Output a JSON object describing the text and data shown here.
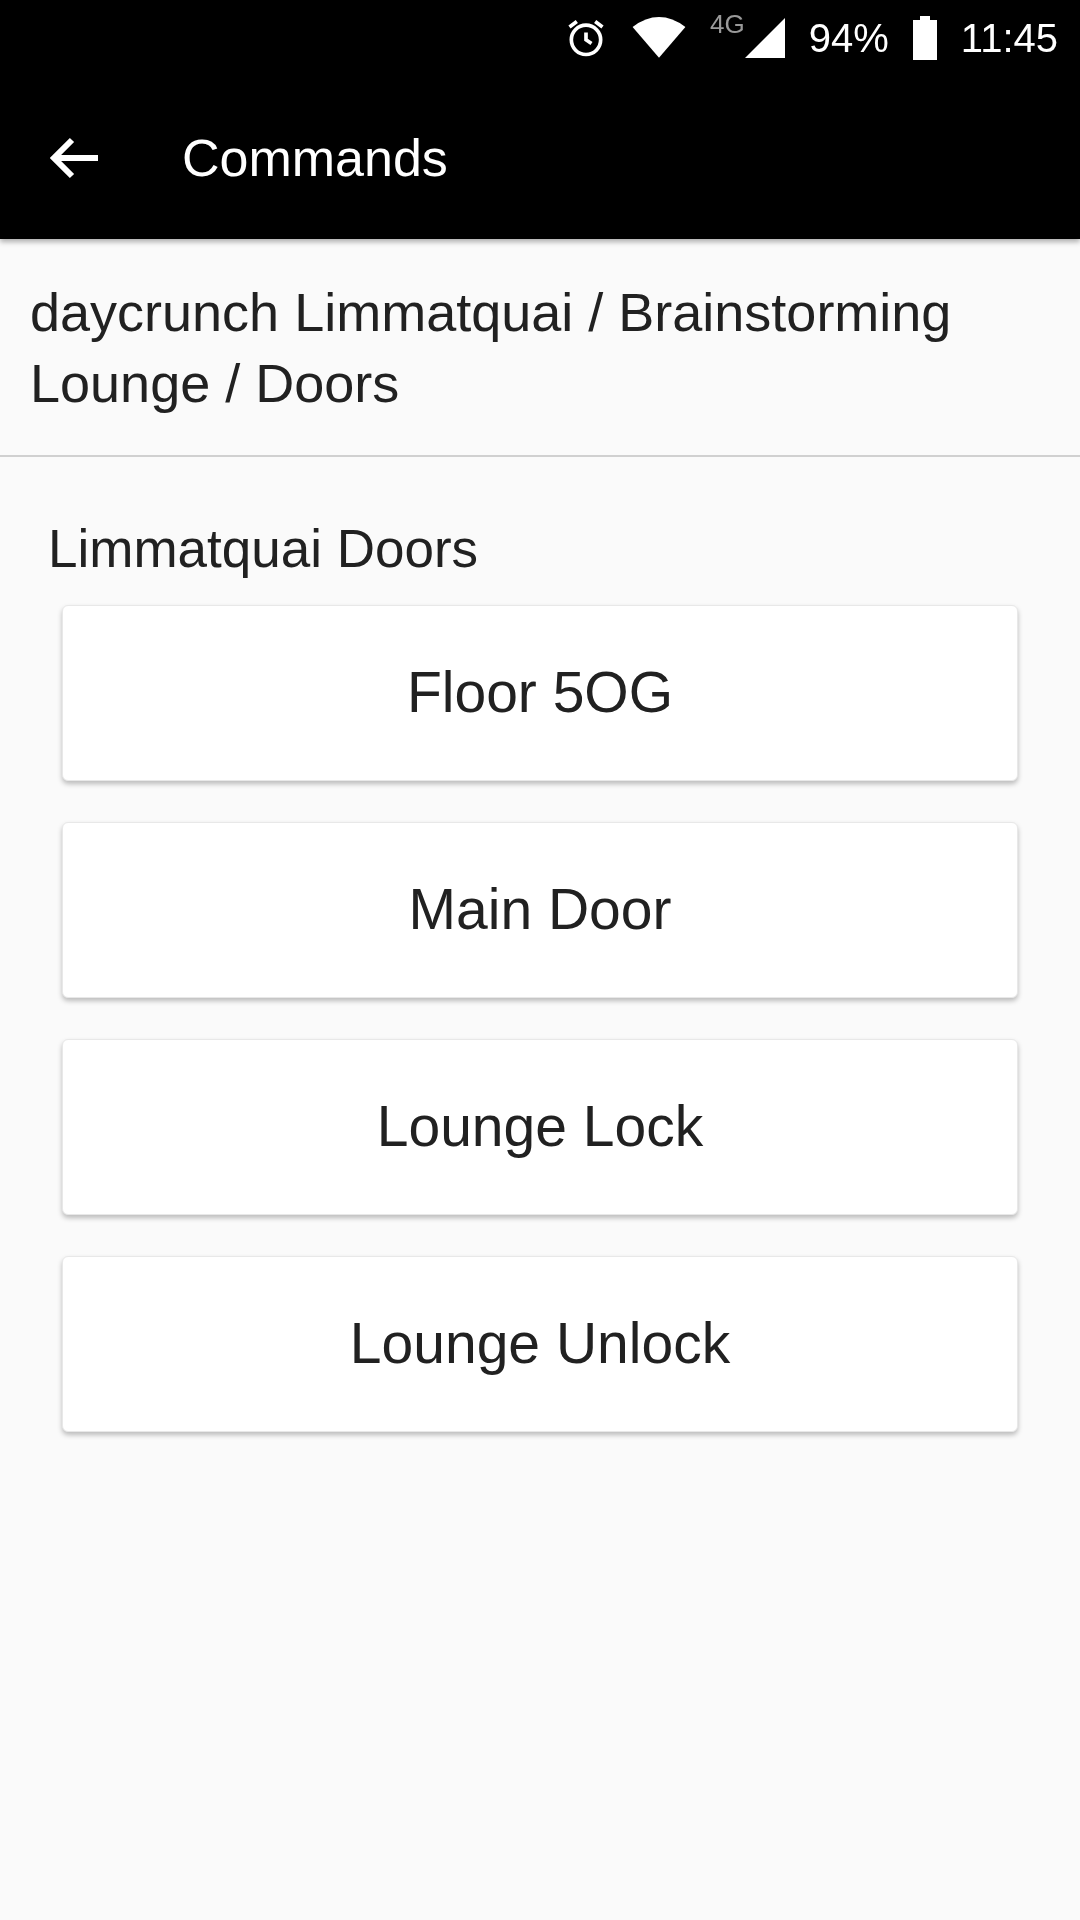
{
  "status_bar": {
    "network": "4G",
    "battery": "94%",
    "time": "11:45"
  },
  "app_bar": {
    "title": "Commands"
  },
  "breadcrumb": "daycrunch Limmatquai / Brainstorming Lounge / Doors",
  "section": {
    "title": "Limmatquai Doors",
    "buttons": [
      {
        "label": "Floor 5OG"
      },
      {
        "label": "Main Door"
      },
      {
        "label": "Lounge Lock"
      },
      {
        "label": "Lounge Unlock"
      }
    ]
  }
}
